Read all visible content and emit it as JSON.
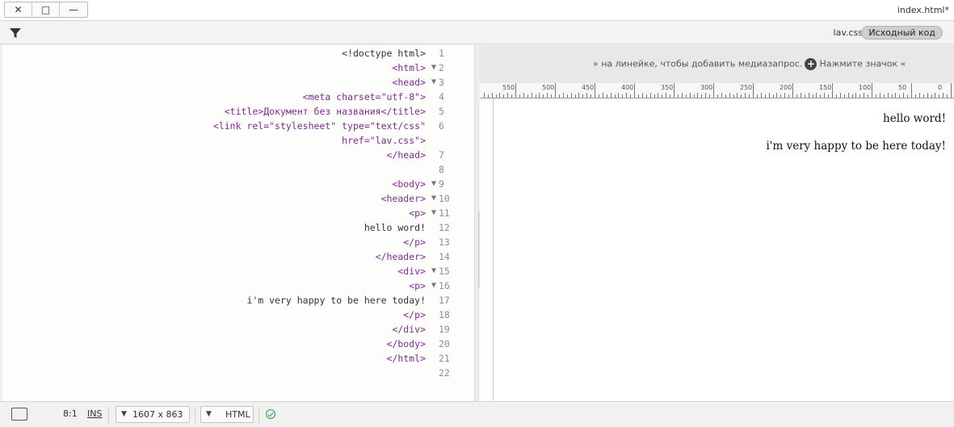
{
  "window": {
    "title": "index.html*",
    "close_glyph": "✕",
    "maximize_glyph": "□",
    "minimize_glyph": "—"
  },
  "files_bar": {
    "source_tab": "Исходный код",
    "css_tab": "lav.css",
    "filter_icon": "filter-icon"
  },
  "code": {
    "lines": [
      {
        "n": "1",
        "fold": "",
        "text": "<!doctype html>",
        "color": "plain"
      },
      {
        "n": "2",
        "fold": "▼",
        "text": "<html>",
        "color": "tag"
      },
      {
        "n": "3",
        "fold": "▼",
        "text": "<head>",
        "color": "tag"
      },
      {
        "n": "4",
        "fold": "",
        "text": "<meta charset=\"utf-8\">",
        "color": "tag"
      },
      {
        "n": "5",
        "fold": "",
        "text": "<title>Документ без названия</title>",
        "color": "tag"
      },
      {
        "n": "6",
        "fold": "",
        "text": "<link rel=\"stylesheet\" type=\"text/css\"",
        "color": "tag"
      },
      {
        "n": "",
        "fold": "",
        "text": "href=\"lav.css\">",
        "color": "tag"
      },
      {
        "n": "7",
        "fold": "",
        "text": "</head>",
        "color": "tag"
      },
      {
        "n": "8",
        "fold": "",
        "text": "",
        "color": "plain"
      },
      {
        "n": "9",
        "fold": "▼",
        "text": "<body>",
        "color": "tag"
      },
      {
        "n": "10",
        "fold": "▼",
        "text": "<header>",
        "color": "tag"
      },
      {
        "n": "11",
        "fold": "▼",
        "text": "<p>",
        "color": "tag"
      },
      {
        "n": "12",
        "fold": "",
        "text": "hello word!",
        "color": "plain"
      },
      {
        "n": "13",
        "fold": "",
        "text": "</p>",
        "color": "tag"
      },
      {
        "n": "14",
        "fold": "",
        "text": "</header>",
        "color": "tag"
      },
      {
        "n": "15",
        "fold": "▼",
        "text": "<div>",
        "color": "tag"
      },
      {
        "n": "16",
        "fold": "▼",
        "text": "<p>",
        "color": "tag"
      },
      {
        "n": "17",
        "fold": "",
        "text": "i'm very happy to be here today!",
        "color": "plain"
      },
      {
        "n": "18",
        "fold": "",
        "text": "</p>",
        "color": "tag"
      },
      {
        "n": "19",
        "fold": "",
        "text": "</div>",
        "color": "tag"
      },
      {
        "n": "20",
        "fold": "",
        "text": "</body>",
        "color": "tag"
      },
      {
        "n": "21",
        "fold": "",
        "text": "</html>",
        "color": "tag"
      },
      {
        "n": "22",
        "fold": "",
        "text": "",
        "color": "plain"
      }
    ]
  },
  "live_view": {
    "media_query_hint_before": "Нажмите значок «",
    "media_query_hint_plus": "+",
    "media_query_hint_after": "» на линейке, чтобы добавить медиазапрос.",
    "ruler_labels": [
      "0",
      "50",
      "100",
      "150",
      "200",
      "250",
      "300",
      "350",
      "400",
      "450",
      "500",
      "550"
    ],
    "output_lines": [
      "hello word!",
      "i'm very happy to be here today!"
    ]
  },
  "status_bar": {
    "doc_type": "HTML",
    "window_size": "1607 x 863",
    "insert_mode": "INS",
    "cursor_position": "8:1",
    "ok_icon": "check-circle-icon",
    "accent_ok": "#2f9a3f"
  }
}
